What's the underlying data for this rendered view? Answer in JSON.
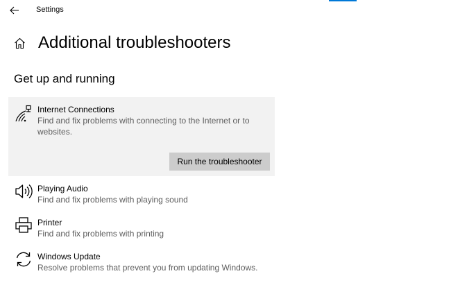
{
  "window": {
    "app_title": "Settings",
    "accent_color": "#0078d7"
  },
  "icons": {
    "back": "back-arrow-icon",
    "home": "home-icon"
  },
  "header": {
    "title": "Additional troubleshooters"
  },
  "section": {
    "title": "Get up and running"
  },
  "troubleshooters": [
    {
      "title": "Internet Connections",
      "description": "Find and fix problems with connecting to the Internet or to websites.",
      "icon": "wifi-network-icon",
      "selected": true,
      "run_label": "Run the troubleshooter"
    },
    {
      "title": "Playing Audio",
      "description": "Find and fix problems with playing sound",
      "icon": "speaker-icon",
      "selected": false
    },
    {
      "title": "Printer",
      "description": "Find and fix problems with printing",
      "icon": "printer-icon",
      "selected": false
    },
    {
      "title": "Windows Update",
      "description": "Resolve problems that prevent you from updating Windows.",
      "icon": "refresh-icon",
      "selected": false
    }
  ],
  "colors": {
    "selected_bg": "#f2f2f2",
    "button_bg": "#cccccc",
    "desc_text": "#5d5d5d"
  }
}
